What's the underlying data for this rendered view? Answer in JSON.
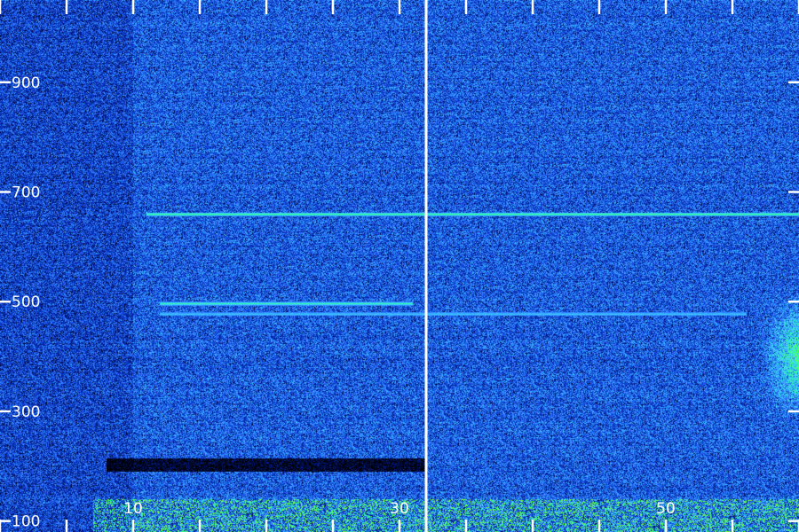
{
  "chart_data": {
    "type": "heatmap",
    "title": "",
    "xlabel": "",
    "ylabel": "",
    "xlim": [
      0,
      60
    ],
    "ylim": [
      80,
      1050
    ],
    "x_ticks": [
      0,
      5,
      10,
      15,
      20,
      25,
      30,
      35,
      40,
      45,
      50,
      55,
      60
    ],
    "x_tick_labels": [
      {
        "value": 10,
        "label": "10"
      },
      {
        "value": 30,
        "label": "30"
      },
      {
        "value": 50,
        "label": "50"
      }
    ],
    "y_ticks": [
      {
        "value": 100,
        "label": "100"
      },
      {
        "value": 300,
        "label": "300"
      },
      {
        "value": 500,
        "label": "500"
      },
      {
        "value": 700,
        "label": "700"
      },
      {
        "value": 900,
        "label": "900"
      }
    ],
    "segment_boundary_x": 32,
    "colormap": [
      "#000000",
      "#000e5a",
      "#0a34c8",
      "#2f7cff",
      "#3fd2ff",
      "#2bff9a",
      "#7dff2a"
    ],
    "features": [
      {
        "kind": "horizontal_line",
        "y": 660,
        "x_range": [
          11,
          60
        ],
        "intensity": 0.9
      },
      {
        "kind": "horizontal_line",
        "y": 497,
        "x_range": [
          12,
          31
        ],
        "intensity": 0.75
      },
      {
        "kind": "horizontal_line",
        "y": 478,
        "x_range": [
          12,
          56
        ],
        "intensity": 0.4
      },
      {
        "kind": "dark_band",
        "y_range": [
          190,
          215
        ],
        "x_range": [
          8,
          32
        ]
      },
      {
        "kind": "bright_region",
        "x_range": [
          57,
          60
        ],
        "y_range": [
          280,
          520
        ]
      },
      {
        "kind": "bright_bursts",
        "y_range": [
          80,
          140
        ],
        "x_range": [
          7,
          60
        ]
      }
    ],
    "grid": false,
    "legend": "none"
  }
}
